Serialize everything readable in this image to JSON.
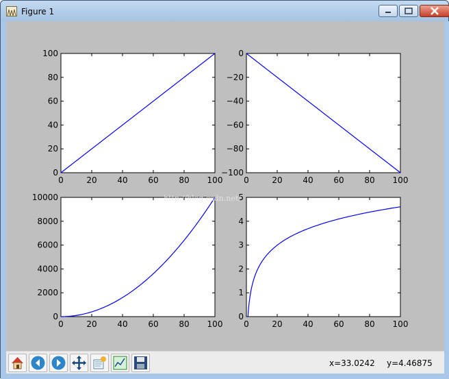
{
  "window": {
    "title": "Figure 1"
  },
  "toolbar": {
    "buttons": [
      "home-icon",
      "back-icon",
      "forward-icon",
      "pan-icon",
      "zoom-icon",
      "configure-subplots-icon",
      "save-icon"
    ],
    "coords": {
      "x": "x=33.0242",
      "y": "y=4.46875"
    }
  },
  "watermark": "http://blog.csdn.net/",
  "chart_data": [
    {
      "type": "line",
      "x": [
        0,
        100
      ],
      "y": [
        0,
        100
      ],
      "xlim": [
        0,
        100
      ],
      "ylim": [
        0,
        100
      ],
      "xticks": [
        "0",
        "20",
        "40",
        "60",
        "80",
        "100"
      ],
      "yticks": [
        "0",
        "20",
        "40",
        "60",
        "80",
        "100"
      ],
      "color": "#0000ff"
    },
    {
      "type": "line",
      "x": [
        0,
        100
      ],
      "y": [
        0,
        -100
      ],
      "xlim": [
        0,
        100
      ],
      "ylim": [
        -100,
        0
      ],
      "xticks": [
        "0",
        "20",
        "40",
        "60",
        "80",
        "100"
      ],
      "yticks": [
        "−100",
        "−80",
        "−60",
        "−40",
        "−20",
        "0"
      ],
      "color": "#0000ff"
    },
    {
      "type": "line",
      "x": [
        0,
        10,
        20,
        30,
        40,
        50,
        60,
        70,
        80,
        90,
        100
      ],
      "y": [
        0,
        100,
        400,
        900,
        1600,
        2500,
        3600,
        4900,
        6400,
        8100,
        10000
      ],
      "xlim": [
        0,
        100
      ],
      "ylim": [
        0,
        10000
      ],
      "xticks": [
        "0",
        "20",
        "40",
        "60",
        "80",
        "100"
      ],
      "yticks": [
        "0",
        "2000",
        "4000",
        "6000",
        "8000",
        "10000"
      ],
      "color": "#0000ff"
    },
    {
      "type": "line",
      "x": [
        1,
        2,
        3,
        5,
        7,
        10,
        15,
        20,
        30,
        40,
        50,
        60,
        70,
        80,
        90,
        100
      ],
      "y": [
        0,
        0.69,
        1.1,
        1.61,
        1.95,
        2.3,
        2.71,
        3.0,
        3.4,
        3.69,
        3.91,
        4.09,
        4.25,
        4.38,
        4.5,
        4.61
      ],
      "xlim": [
        0,
        100
      ],
      "ylim": [
        0,
        5
      ],
      "xticks": [
        "0",
        "20",
        "40",
        "60",
        "80",
        "100"
      ],
      "yticks": [
        "0",
        "1",
        "2",
        "3",
        "4",
        "5"
      ],
      "color": "#0000ff"
    }
  ]
}
